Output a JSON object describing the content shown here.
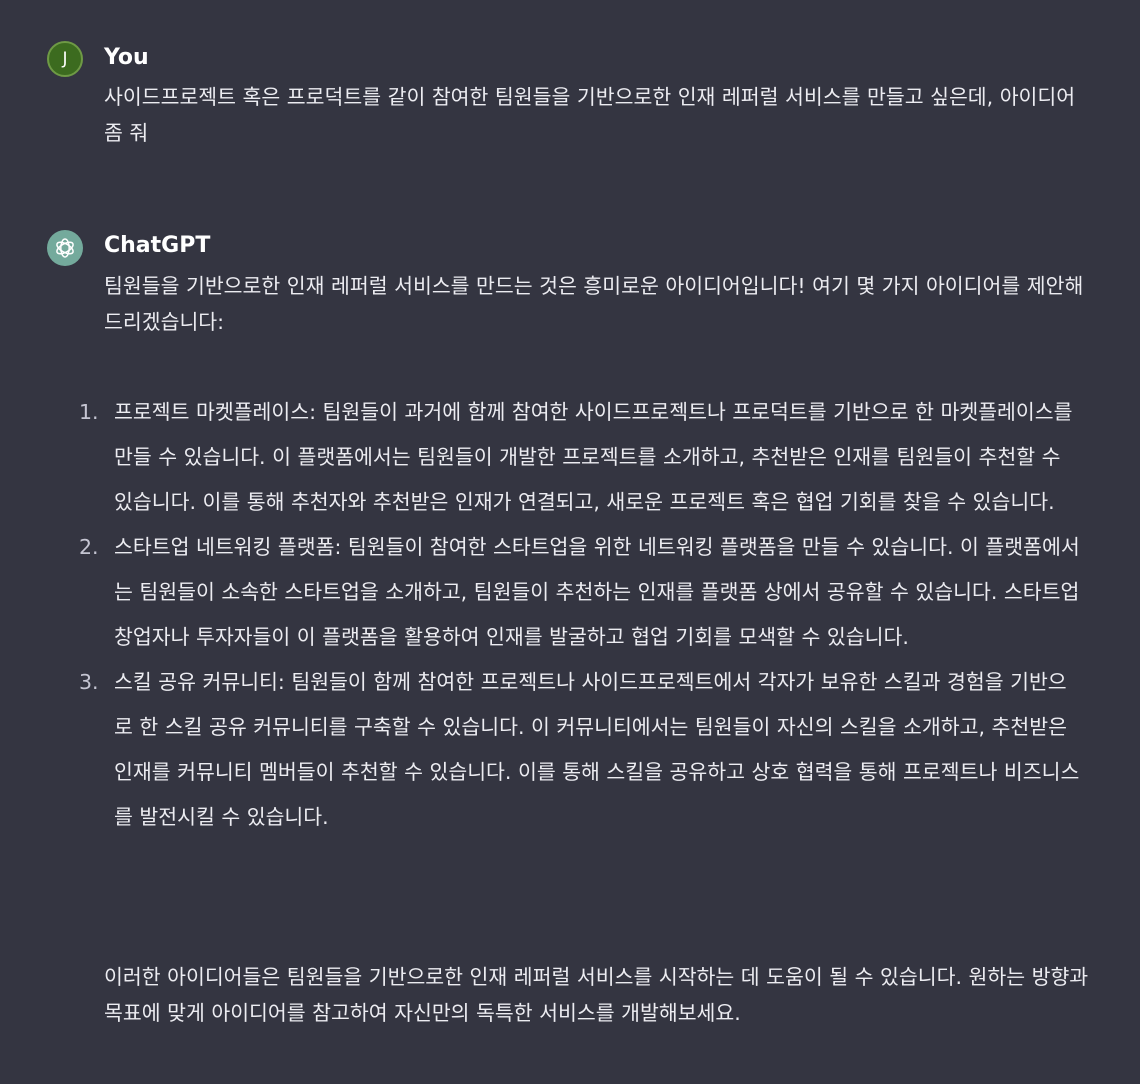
{
  "user_message": {
    "avatar_letter": "J",
    "author": "You",
    "text": "사이드프로젝트 혹은 프로덕트를 같이 참여한 팀원들을 기반으로한 인재 레퍼럴 서비스를 만들고 싶은데, 아이디어 좀 줘"
  },
  "assistant_message": {
    "author": "ChatGPT",
    "intro": "팀원들을 기반으로한 인재 레퍼럴 서비스를 만드는 것은 흥미로운 아이디어입니다! 여기 몇 가지 아이디어를 제안해 드리겠습니다:",
    "items": [
      {
        "number": "1.",
        "text": "프로젝트 마켓플레이스: 팀원들이 과거에 함께 참여한 사이드프로젝트나 프로덕트를 기반으로 한 마켓플레이스를 만들 수 있습니다. 이 플랫폼에서는 팀원들이 개발한 프로젝트를 소개하고, 추천받은 인재를 팀원들이 추천할 수 있습니다. 이를 통해 추천자와 추천받은 인재가 연결되고, 새로운 프로젝트 혹은 협업 기회를 찾을 수 있습니다."
      },
      {
        "number": "2.",
        "text": "스타트업 네트워킹 플랫폼: 팀원들이 참여한 스타트업을 위한 네트워킹 플랫폼을 만들 수 있습니다. 이 플랫폼에서는 팀원들이 소속한 스타트업을 소개하고, 팀원들이 추천하는 인재를 플랫폼 상에서 공유할 수 있습니다. 스타트업 창업자나 투자자들이 이 플랫폼을 활용하여 인재를 발굴하고 협업 기회를 모색할 수 있습니다."
      },
      {
        "number": "3.",
        "text": "스킬 공유 커뮤니티: 팀원들이 함께 참여한 프로젝트나 사이드프로젝트에서 각자가 보유한 스킬과 경험을 기반으로 한 스킬 공유 커뮤니티를 구축할 수 있습니다. 이 커뮤니티에서는 팀원들이 자신의 스킬을 소개하고, 추천받은 인재를 커뮤니티 멤버들이 추천할 수 있습니다. 이를 통해 스킬을 공유하고 상호 협력을 통해 프로젝트나 비즈니스를 발전시킬 수 있습니다."
      }
    ],
    "outro": "이러한 아이디어들은 팀원들을 기반으로한 인재 레퍼럴 서비스를 시작하는 데 도움이 될 수 있습니다. 원하는 방향과 목표에 맞게 아이디어를 참고하여 자신만의 독특한 서비스를 개발해보세요."
  },
  "colors": {
    "background": "#343541",
    "text": "#ececf1",
    "user_avatar": "#3c6b1f",
    "assistant_avatar": "#74aa9c"
  },
  "icons": {
    "assistant_avatar": "openai-logo-icon"
  }
}
